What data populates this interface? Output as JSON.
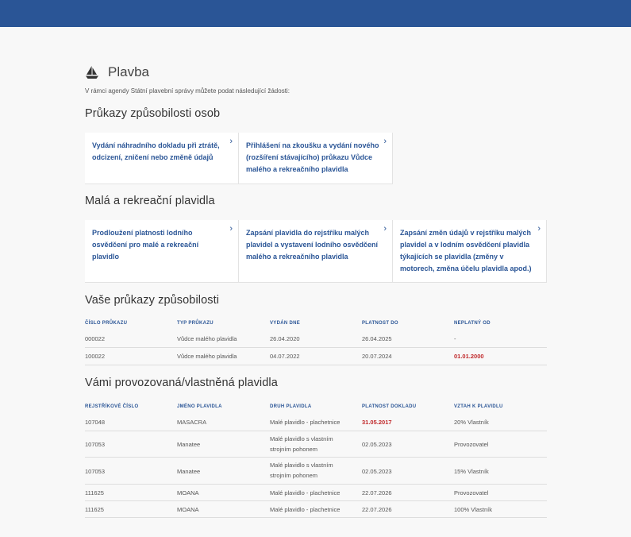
{
  "page": {
    "title": "Plavba",
    "intro": "V rámci agendy Státní plavební správy můžete podat následující žádosti:"
  },
  "section1": {
    "title": "Průkazy způsobilosti osob",
    "cards": [
      "Vydání náhradního dokladu při ztrátě, odcizení, zničení nebo změně údajů",
      "Přihlášení na zkoušku a vydání nového (rozšíření stávajícího) průkazu Vůdce malého a rekreačního plavidla"
    ]
  },
  "section2": {
    "title": "Malá a rekreační plavidla",
    "cards": [
      "Prodloužení platnosti lodního osvědčení pro malé a rekreační plavidlo",
      "Zapsání plavidla do rejstříku malých plavidel a vystavení lodního osvědčení malého a rekreačního plavidla",
      "Zapsání změn údajů v rejstříku malých plavidel a v lodním osvědčení plavidla týkajících se plavidla (změny v motorech, změna účelu plavidla apod.)"
    ]
  },
  "licenses": {
    "title": "Vaše průkazy způsobilosti",
    "headers": [
      "ČÍSLO PRŮKAZU",
      "TYP PRŮKAZU",
      "VYDÁN DNE",
      "PLATNOST DO",
      "NEPLATNÝ OD"
    ],
    "rows": [
      [
        "000022",
        "Vůdce malého plavidla",
        "26.04.2020",
        "26.04.2025",
        "-"
      ],
      [
        "100022",
        "Vůdce malého plavidla",
        "04.07.2022",
        "20.07.2024",
        "01.01.2000"
      ]
    ]
  },
  "vessels": {
    "title": "Vámi provozovaná/vlastněná plavidla",
    "headers": [
      "REJSTŘÍKOVÉ ČÍSLO",
      "JMÉNO PLAVIDLA",
      "DRUH PLAVIDLA",
      "PLATNOST DOKLADU",
      "VZTAH K PLAVIDLU"
    ],
    "rows": [
      [
        "107048",
        "MASACRA",
        "Malé plavidlo - plachetnice",
        "31.05.2017",
        "20% Vlastník"
      ],
      [
        "107053",
        "Manatee",
        "Malé plavidlo s vlastním strojním pohonem",
        "02.05.2023",
        "Provozovatel"
      ],
      [
        "107053",
        "Manatee",
        "Malé plavidlo s vlastním strojním pohonem",
        "02.05.2023",
        "15% Vlastník"
      ],
      [
        "111625",
        "MOANA",
        "Malé plavidlo - plachetnice",
        "22.07.2026",
        "Provozovatel"
      ],
      [
        "111625",
        "MOANA",
        "Malé plavidlo - plachetnice",
        "22.07.2026",
        "100% Vlastník"
      ]
    ]
  },
  "colors": {
    "header": "#2a5596",
    "link": "#2a5596",
    "alert": "#c0292b"
  },
  "icons": {
    "title": "sailboat-icon",
    "card": "chevron-right-icon"
  }
}
